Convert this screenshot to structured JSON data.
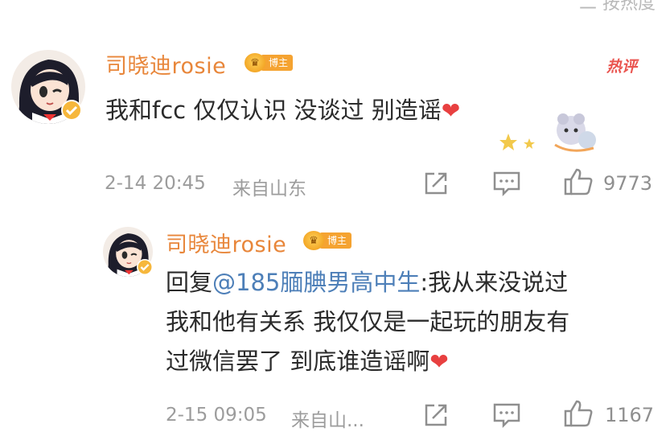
{
  "sort_label": "二 按热度",
  "comment": {
    "author": "司晓迪rosie",
    "badge": "博主",
    "hot_label": "热评",
    "text": "我和fcc 仅仅认识 没谈过 别造谣",
    "time": "2-14 20:45",
    "location": "来自山东",
    "likes": "9773"
  },
  "reply": {
    "author": "司晓迪rosie",
    "badge": "博主",
    "reply_prefix": "回复",
    "mention": "@185腼腆男高中生",
    "line1_rest": ":我从来没说过",
    "line2": "我和他有关系 我仅仅是一起玩的朋友有",
    "line3": "过微信罢了 到底谁造谣啊",
    "time": "2-15 09:05",
    "location": "来自山...",
    "likes": "1167"
  },
  "icons": {
    "share": "share-icon",
    "comment": "comment-icon",
    "like": "thumbs-up-icon",
    "heart": "heart-icon",
    "verified": "verified-badge-icon"
  },
  "colors": {
    "name": "#e8863a",
    "badge": "#f5a331",
    "hot": "#ea5550",
    "mention": "#4d7fb8",
    "meta": "#9c9c9c"
  }
}
